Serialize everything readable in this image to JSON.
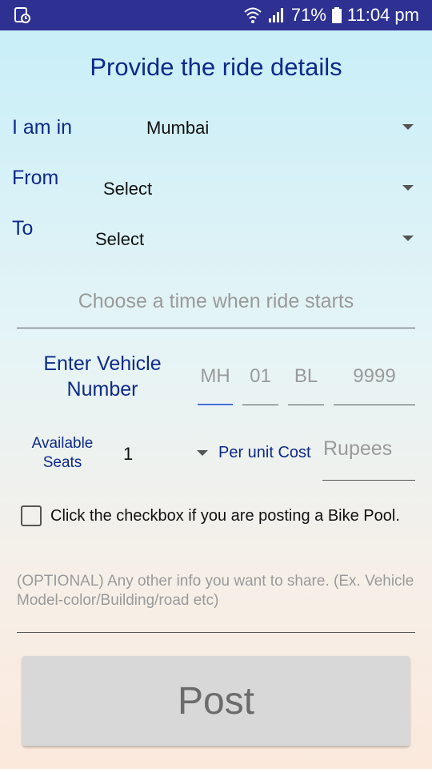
{
  "status_bar": {
    "battery_percent": "71%",
    "time": "11:04 pm",
    "icons": [
      "app-notification-icon",
      "wifi-icon",
      "signal-icon",
      "battery-icon"
    ]
  },
  "title": "Provide the ride details",
  "city": {
    "label": "I am in",
    "value": "Mumbai"
  },
  "from": {
    "label": "From",
    "value": "Select"
  },
  "to": {
    "label": "To",
    "value": "Select"
  },
  "time_field": {
    "placeholder": "Choose a time when ride starts"
  },
  "vehicle": {
    "label_line1": "Enter Vehicle",
    "label_line2": "Number",
    "parts": [
      "MH",
      "01",
      "BL",
      "9999"
    ]
  },
  "seats": {
    "label_line1": "Available",
    "label_line2": "Seats",
    "value": "1"
  },
  "cost": {
    "label": "Per unit Cost",
    "placeholder": "Rupees"
  },
  "bike_pool": {
    "label": "Click the checkbox if you are posting a Bike Pool.",
    "checked": false
  },
  "info_field": {
    "placeholder": "(OPTIONAL) Any other info you want to share. (Ex. Vehicle Model-color/Building/road etc)"
  },
  "post_button": {
    "label": "Post"
  },
  "colors": {
    "status_bar": "#2e3192",
    "label": "#0e2a8a",
    "placeholder": "#9a9a9a",
    "focus_underline": "#4a6fd6",
    "button": "#d8d8d8"
  }
}
